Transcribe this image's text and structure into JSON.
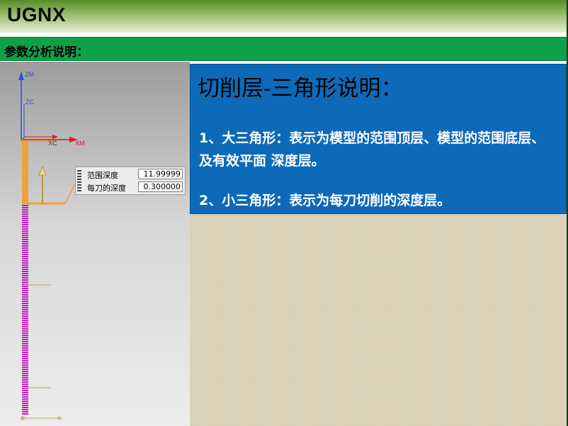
{
  "header": {
    "title": "UGNX"
  },
  "section": {
    "title": "参数分析说明："
  },
  "viewport": {
    "axes": {
      "zm": "ZM",
      "zc": "ZC",
      "xc": "XC",
      "xm": "XM"
    },
    "depth_box": {
      "range_depth_label": "范围深度",
      "range_depth_value": "11.99999",
      "cut_depth_label": "每刀的深度",
      "cut_depth_value": "0.300000"
    }
  },
  "panel": {
    "title": "切削层-三角形说明：",
    "note1": "1、大三角形：表示为模型的范围顶层、模型的范围底层、及有效平面 深度层。",
    "note2": "2、小三角形：表示为每刀切削的深度层。"
  },
  "colors": {
    "header_dark": "#5a8a2c",
    "section_green": "#0fa14a",
    "panel_blue": "#0d6ab8",
    "layer_magenta": "#c020c0",
    "range_orange": "#f0a040"
  }
}
